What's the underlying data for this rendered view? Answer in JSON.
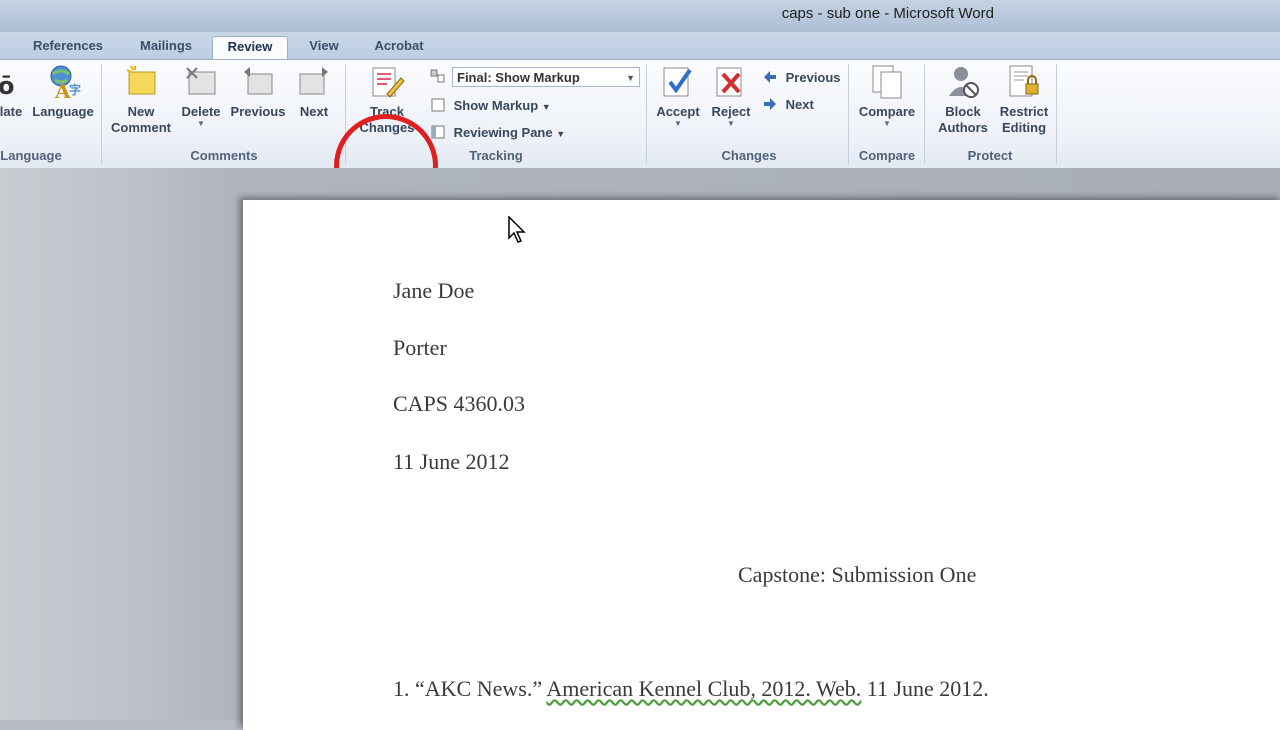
{
  "window": {
    "title": "caps - sub one - Microsoft Word"
  },
  "tabs": [
    {
      "label": "References",
      "active": false
    },
    {
      "label": "Mailings",
      "active": false
    },
    {
      "label": "Review",
      "active": true
    },
    {
      "label": "View",
      "active": false
    },
    {
      "label": "Acrobat",
      "active": false
    }
  ],
  "ribbon": {
    "language_group": {
      "label": "Language",
      "translate_label": "late",
      "language_label": "Language"
    },
    "comments_group": {
      "label": "Comments",
      "new_comment": "New\nComment",
      "delete": "Delete",
      "previous": "Previous",
      "next": "Next"
    },
    "tracking_group": {
      "label": "Tracking",
      "track_changes": "Track\nChanges",
      "display_mode": "Final: Show Markup",
      "show_markup": "Show Markup",
      "reviewing_pane": "Reviewing Pane"
    },
    "changes_group": {
      "label": "Changes",
      "accept": "Accept",
      "reject": "Reject",
      "previous": "Previous",
      "next": "Next"
    },
    "compare_group": {
      "label": "Compare",
      "compare": "Compare"
    },
    "protect_group": {
      "label": "Protect",
      "block_authors": "Block\nAuthors",
      "restrict_editing": "Restrict\nEditing"
    }
  },
  "document": {
    "name": "Jane Doe",
    "instructor": "Porter",
    "course": "CAPS 4360.03",
    "date": "11 June 2012",
    "title": "Capstone: Submission One",
    "citation_prefix": "1. “AKC News.” ",
    "citation_underlined": "American Kennel Club, 2012. Web.",
    "citation_suffix": " 11 June 2012."
  },
  "colors": {
    "annotation_circle": "#e02020",
    "spellcheck_underline": "#4a9a3a"
  }
}
